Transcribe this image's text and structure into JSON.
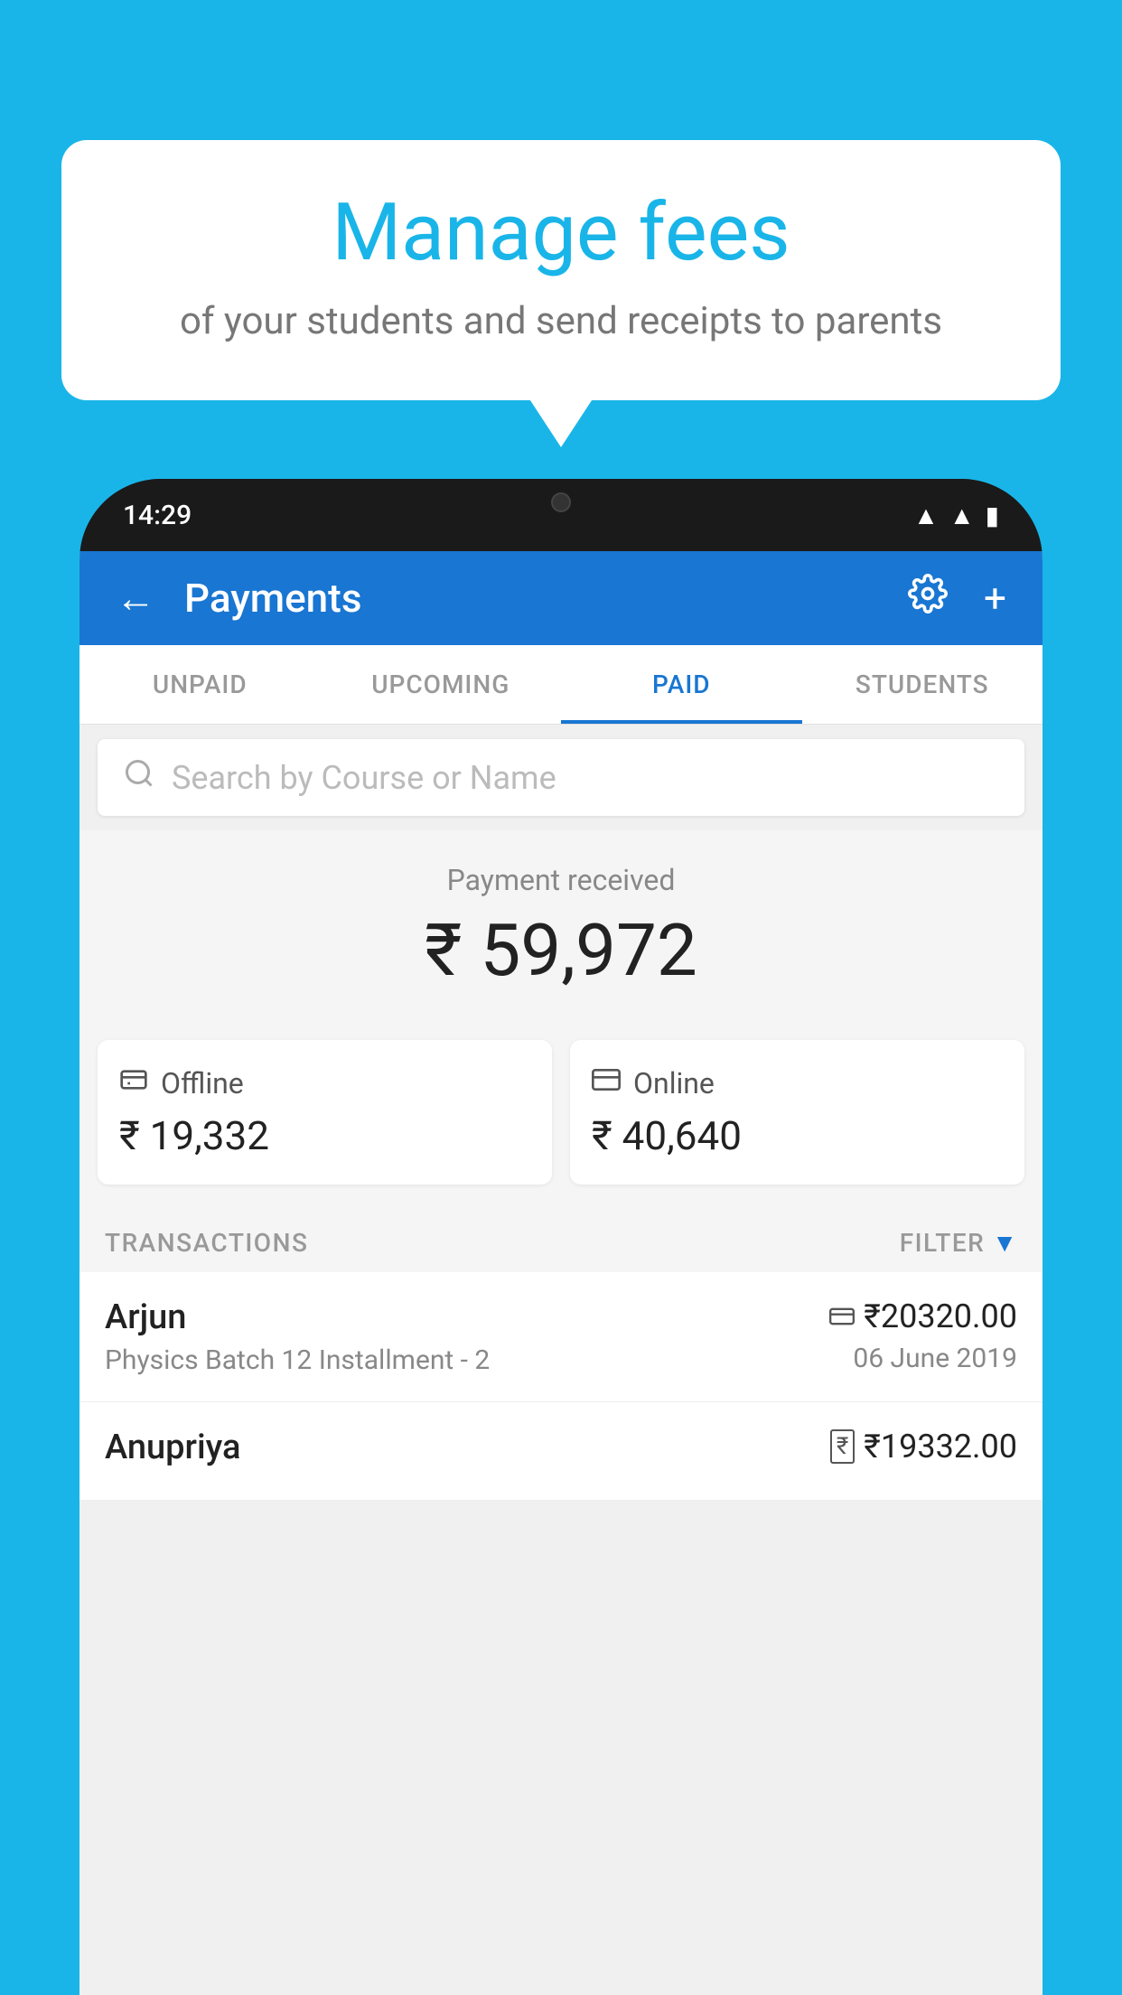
{
  "background_color": "#1ab5e8",
  "speech_bubble": {
    "title": "Manage fees",
    "subtitle": "of your students and send receipts to parents"
  },
  "phone": {
    "status_bar": {
      "time": "14:29",
      "icons": [
        "wifi",
        "signal",
        "battery"
      ]
    },
    "app_bar": {
      "title": "Payments",
      "back_label": "←",
      "settings_label": "⚙",
      "add_label": "+"
    },
    "tabs": [
      {
        "label": "UNPAID",
        "active": false
      },
      {
        "label": "UPCOMING",
        "active": false
      },
      {
        "label": "PAID",
        "active": true
      },
      {
        "label": "STUDENTS",
        "active": false
      }
    ],
    "search": {
      "placeholder": "Search by Course or Name"
    },
    "payment_received": {
      "label": "Payment received",
      "amount": "₹ 59,972"
    },
    "cards": [
      {
        "type": "Offline",
        "amount": "₹ 19,332",
        "icon": "rupee-box"
      },
      {
        "type": "Online",
        "amount": "₹ 40,640",
        "icon": "card"
      }
    ],
    "transactions_label": "TRANSACTIONS",
    "filter_label": "FILTER",
    "transactions": [
      {
        "name": "Arjun",
        "detail": "Physics Batch 12 Installment - 2",
        "amount": "₹20320.00",
        "date": "06 June 2019",
        "payment_type": "online"
      },
      {
        "name": "Anupriya",
        "detail": "",
        "amount": "₹19332.00",
        "date": "",
        "payment_type": "offline"
      }
    ]
  }
}
